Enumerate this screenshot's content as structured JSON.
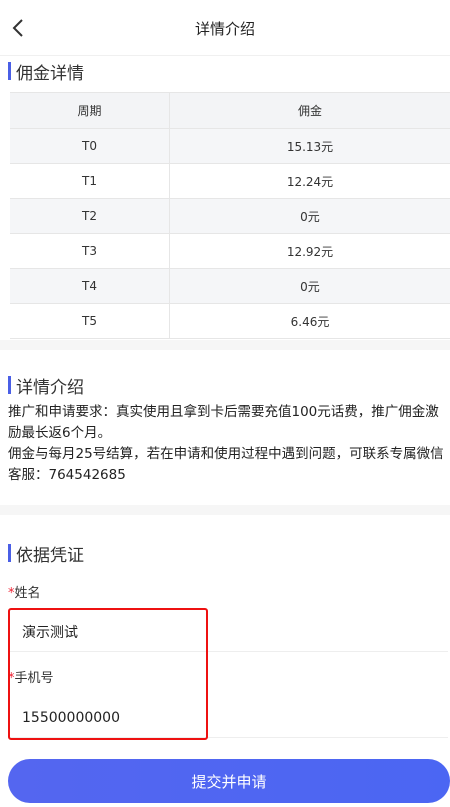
{
  "header": {
    "title": "详情介绍"
  },
  "commission": {
    "section_title": "佣金详情",
    "columns": [
      "周期",
      "佣金"
    ],
    "rows": [
      {
        "period": "T0",
        "amount": "15.13元"
      },
      {
        "period": "T1",
        "amount": "12.24元"
      },
      {
        "period": "T2",
        "amount": "0元"
      },
      {
        "period": "T3",
        "amount": "12.92元"
      },
      {
        "period": "T4",
        "amount": "0元"
      },
      {
        "period": "T5",
        "amount": "6.46元"
      }
    ]
  },
  "details": {
    "section_title": "详情介绍",
    "line1": "推广和申请要求：真实使用且拿到卡后需要充值100元话费，推广佣金激励最长返6个月。",
    "line2": "佣金与每月25号结算，若在申请和使用过程中遇到问题，可联系专属微信客服：764542685"
  },
  "proof": {
    "section_title": "依据凭证",
    "name_label": "姓名",
    "name_value": "演示测试",
    "phone_label": "手机号",
    "phone_value": "15500000000",
    "required_mark": "*"
  },
  "submit_label": "提交并申请",
  "colors": {
    "accent": "#4a5fe6",
    "highlight_box": "#ee1111"
  }
}
